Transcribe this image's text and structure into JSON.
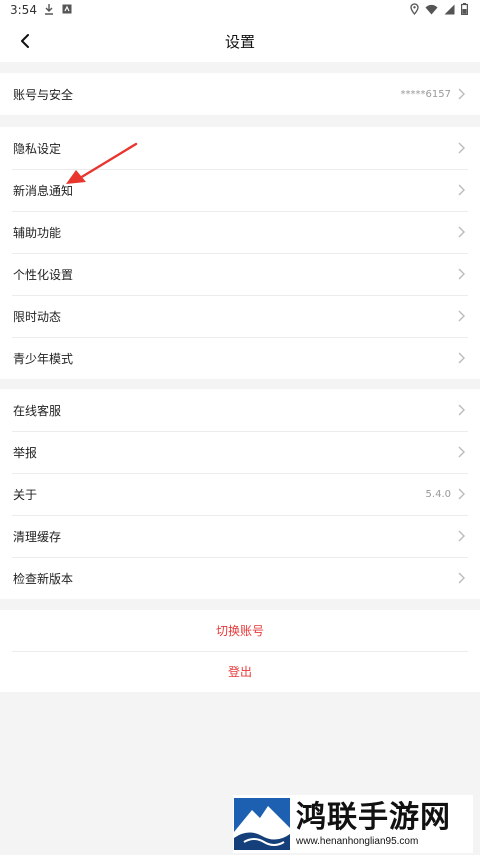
{
  "status_bar": {
    "time": "3:54",
    "left_icons": [
      "download-icon",
      "app-notification-icon"
    ],
    "right_icons": [
      "location-icon",
      "wifi-icon",
      "signal-icon",
      "battery-icon"
    ]
  },
  "header": {
    "title": "设置",
    "back_icon": "chevron-left-icon"
  },
  "account_group": {
    "items": [
      {
        "label": "账号与安全",
        "value": "*****6157"
      }
    ]
  },
  "privacy_group": {
    "items": [
      {
        "label": "隐私设定"
      },
      {
        "label": "新消息通知"
      },
      {
        "label": "辅助功能"
      },
      {
        "label": "个性化设置"
      },
      {
        "label": "限时动态"
      },
      {
        "label": "青少年模式"
      }
    ]
  },
  "support_group": {
    "items": [
      {
        "label": "在线客服"
      },
      {
        "label": "举报"
      },
      {
        "label": "关于",
        "value": "5.4.0"
      },
      {
        "label": "清理缓存"
      },
      {
        "label": "检查新版本"
      }
    ]
  },
  "actions": {
    "switch_account": "切换账号",
    "logout": "登出"
  },
  "annotation": {
    "arrow_color": "#e8362f"
  },
  "watermark": {
    "brand": "鸿联手游网",
    "url": "www.henanhonglian95.com"
  },
  "colors": {
    "page_background": "#f4f4f5",
    "danger_text": "#e83a3a",
    "chevron": "#bbbbbb"
  }
}
